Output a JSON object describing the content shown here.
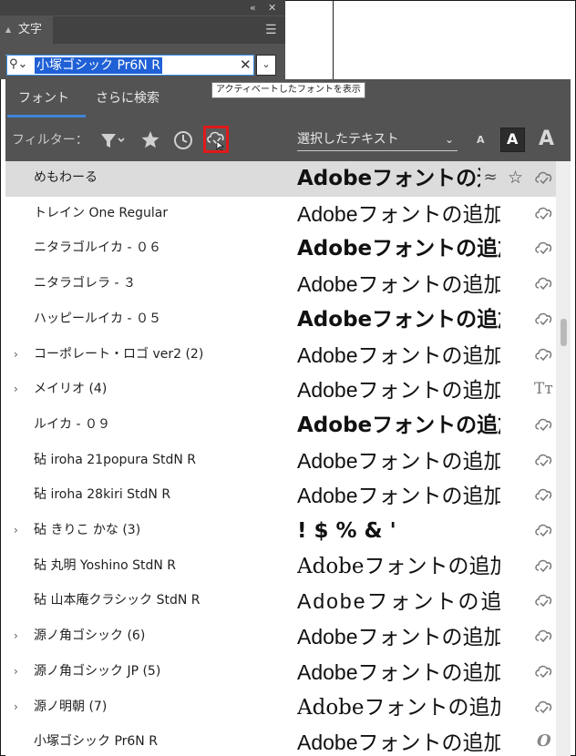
{
  "panel": {
    "collapse_icon": "«",
    "close_icon": "✕",
    "tab_label": "文字",
    "menu_icon": "☰"
  },
  "search": {
    "value": "小塚ゴシック Pr6N R",
    "clear_icon": "✕",
    "dropdown_icon": "⌄"
  },
  "popup": {
    "tabs": [
      "フォント",
      "さらに検索"
    ],
    "filter_label": "フィルター：",
    "sample_text": "選択したテキスト",
    "size_labels": [
      "A",
      "A",
      "A"
    ],
    "tooltip": "アクティベートしたフォントを表示"
  },
  "fonts": [
    {
      "name": "めもわーる",
      "preview": "Adobeフォントの追加",
      "expand": "",
      "status": "cloud",
      "hover": true
    },
    {
      "name": "トレイン One Regular",
      "preview": "Adobeフォントの追加",
      "expand": "",
      "status": "cloud"
    },
    {
      "name": "ニタラゴルイカ - ０６",
      "preview": "Adobeフォントの追加",
      "expand": "",
      "status": "cloud"
    },
    {
      "name": "ニタラゴレラ - ３",
      "preview": "Adobeフォントの追加",
      "expand": "",
      "status": "cloud"
    },
    {
      "name": "ハッピールイカ - ０５",
      "preview": "Adobeフォントの追加",
      "expand": "",
      "status": "cloud"
    },
    {
      "name": "コーポレート・ロゴ ver2 (2)",
      "preview": "Adobeフォントの追加",
      "expand": "›",
      "status": "cloud"
    },
    {
      "name": "メイリオ (4)",
      "preview": "Adobeフォントの追加",
      "expand": "›",
      "status": "truetype"
    },
    {
      "name": "ルイカ - ０９",
      "preview": "Adobeフォントの追加",
      "expand": "",
      "status": "cloud"
    },
    {
      "name": "砧 iroha 21popura StdN R",
      "preview": "Adobeフォントの追加",
      "expand": "",
      "status": "cloud"
    },
    {
      "name": "砧 iroha 28kiri StdN R",
      "preview": "Adobeフォントの追加",
      "expand": "",
      "status": "cloud"
    },
    {
      "name": "砧 きりこ かな (3)",
      "preview": "! $ % & '",
      "expand": "›",
      "status": "cloud"
    },
    {
      "name": "砧 丸明 Yoshino StdN R",
      "preview": "Adobeフォントの追加",
      "expand": "",
      "status": "cloud"
    },
    {
      "name": "砧 山本庵クラシック StdN R",
      "preview": "Adobeフォントの追加",
      "expand": "",
      "status": "cloud"
    },
    {
      "name": "源ノ角ゴシック (6)",
      "preview": "Adobeフォントの追加",
      "expand": "›",
      "status": "cloud"
    },
    {
      "name": "源ノ角ゴシック JP (5)",
      "preview": "Adobeフォントの追加",
      "expand": "›",
      "status": "cloud"
    },
    {
      "name": "源ノ明朝 (7)",
      "preview": "Adobeフォントの追加",
      "expand": "›",
      "status": "cloud"
    },
    {
      "name": "小塚ゴシック Pr6N R",
      "preview": "Adobeフォントの追加",
      "expand": "",
      "status": "opentype"
    }
  ],
  "hover_row": {
    "approx_icon": "≈",
    "star_icon": "☆"
  },
  "status_glyphs": {
    "truetype": "Tт",
    "opentype": "O"
  }
}
